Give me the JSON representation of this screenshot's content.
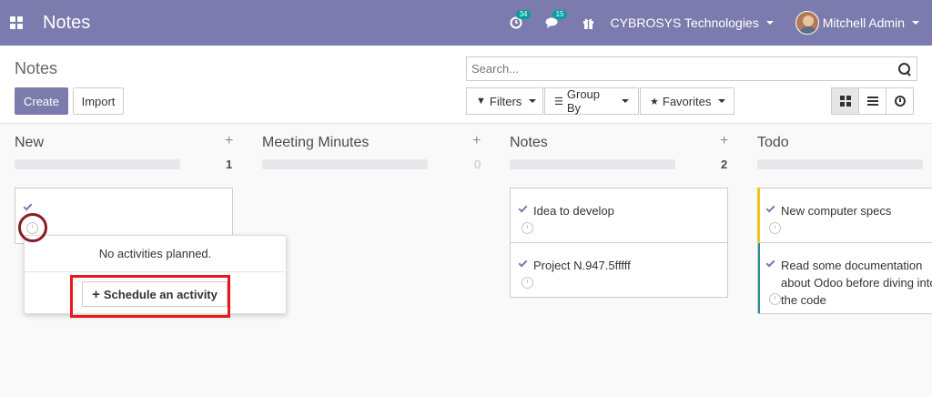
{
  "navbar": {
    "app_title": "Notes",
    "activity_badge": "34",
    "messages_badge": "15",
    "company": "CYBROSYS Technologies",
    "user": "Mitchell Admin"
  },
  "control_panel": {
    "breadcrumb": "Notes",
    "create_label": "Create",
    "import_label": "Import",
    "search_placeholder": "Search...",
    "filters_label": "Filters",
    "group_by_label": "Group By",
    "favorites_label": "Favorites"
  },
  "columns": [
    {
      "title": "New",
      "count": "1"
    },
    {
      "title": "Meeting Minutes",
      "count": "0"
    },
    {
      "title": "Notes",
      "count": "2"
    },
    {
      "title": "Todo",
      "count": ""
    }
  ],
  "cards": {
    "notes": [
      "Idea to develop",
      "Project N.947.5fffff"
    ],
    "todo": [
      "New computer specs",
      "Read some documentation about Odoo before diving into the code"
    ]
  },
  "popover": {
    "message": "No activities planned.",
    "schedule_label": "Schedule an activity"
  },
  "colors": {
    "navbar": "#7c7bad",
    "primary": "#7c7bad",
    "badge": "#00a09d",
    "todo_card1_bar": "#f0c419",
    "todo_card2_bar": "#2a8c95",
    "highlight_box": "#e4191d",
    "highlight_circle": "#8b1b24"
  }
}
